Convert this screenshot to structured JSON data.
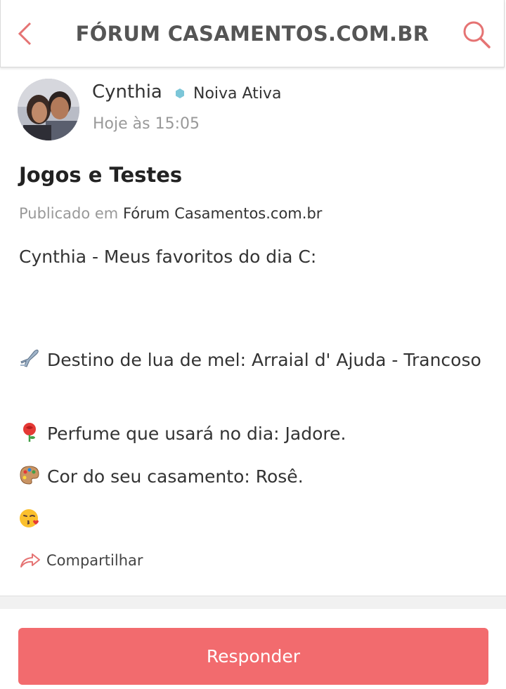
{
  "header": {
    "title": "FÓRUM CASAMENTOS.COM.BR",
    "back_icon": "chevron-left-icon",
    "search_icon": "search-icon",
    "accent_color": "#e57373"
  },
  "post": {
    "author": "Cynthia",
    "badge": "Noiva Ativa",
    "badge_color": "#7cc6d8",
    "timestamp": "Hoje às 15:05",
    "title": "Jogos e Testes",
    "published_prefix": "Publicado em",
    "published_forum": "Fórum Casamentos.com.br",
    "lines": {
      "intro": "Cynthia - Meus favoritos do dia C:",
      "destino": "Destino de lua de mel: Arraial d' Ajuda - Trancoso",
      "perfume": "Perfume que usará no dia: Jadore.",
      "cor": "Cor do seu casamento: Rosê."
    },
    "emojis": {
      "destino": "airplane-icon",
      "perfume": "rose-icon",
      "cor": "palette-icon",
      "closing": "kiss-face-icon"
    },
    "share_label": "Compartilhar"
  },
  "footer": {
    "reply_label": "Responder",
    "reply_color": "#f26b6e"
  }
}
